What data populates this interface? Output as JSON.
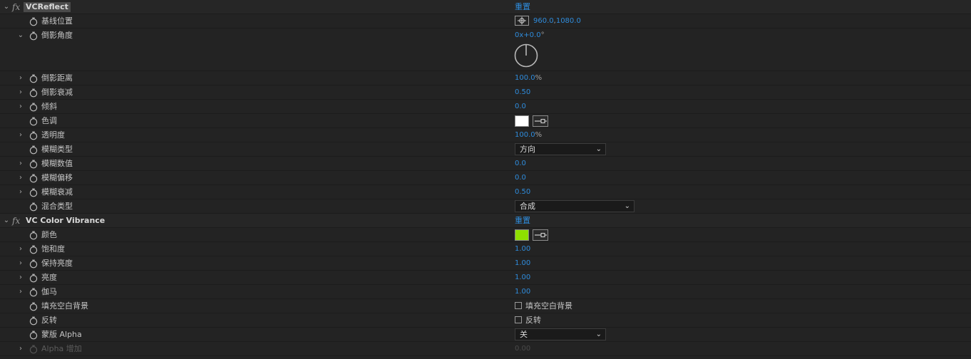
{
  "effects": [
    {
      "fx": "fx",
      "name": "VCReflect",
      "reset": "重置",
      "params": {
        "base_position": {
          "label": "基线位置",
          "x": "960.0",
          "sep": ",",
          "y": "1080.0"
        },
        "reflect_angle": {
          "label": "倒影角度",
          "revolutions": "0x",
          "degrees": "+0.0",
          "unit": "°"
        },
        "reflect_distance": {
          "label": "倒影距离",
          "value": "100.0",
          "unit": "%"
        },
        "reflect_falloff": {
          "label": "倒影衰减",
          "value": "0.50"
        },
        "skew": {
          "label": "倾斜",
          "value": "0.0"
        },
        "tint": {
          "label": "色调",
          "color": "#ffffff"
        },
        "opacity": {
          "label": "透明度",
          "value": "100.0",
          "unit": "%"
        },
        "blur_type": {
          "label": "模糊类型",
          "selected": "方向"
        },
        "blur_amount": {
          "label": "模糊数值",
          "value": "0.0"
        },
        "blur_offset": {
          "label": "模糊偏移",
          "value": "0.0"
        },
        "blur_falloff": {
          "label": "模糊衰减",
          "value": "0.50"
        },
        "blend_type": {
          "label": "混合类型",
          "selected": "合成"
        }
      }
    },
    {
      "fx": "fx",
      "name": "VC Color Vibrance",
      "reset": "重置",
      "params": {
        "color": {
          "label": "颜色",
          "color": "#8ee000"
        },
        "saturation": {
          "label": "饱和度",
          "value": "1.00"
        },
        "preserve_luminance": {
          "label": "保持亮度",
          "value": "1.00"
        },
        "brightness": {
          "label": "亮度",
          "value": "1.00"
        },
        "gamma": {
          "label": "伽马",
          "value": "1.00"
        },
        "fill_blank": {
          "label": "填充空白背景",
          "checkbox_label": "填充空白背景",
          "checked": false
        },
        "invert": {
          "label": "反转",
          "checkbox_label": "反转",
          "checked": false
        },
        "matte_alpha": {
          "label": "蒙版 Alpha",
          "selected": "关"
        },
        "alpha_add": {
          "label": "Alpha 增加",
          "value": "0.00"
        }
      }
    }
  ],
  "colors": {
    "background": "#232323",
    "value_blue": "#2f8cdc",
    "label": "#c4c4c4"
  },
  "icons": {
    "twirl_open": "chevron-down-icon",
    "twirl_closed": "chevron-right-icon",
    "stopwatch": "stopwatch-icon",
    "eyedropper": "eyedropper-icon",
    "crosshair": "crosshair-icon"
  }
}
